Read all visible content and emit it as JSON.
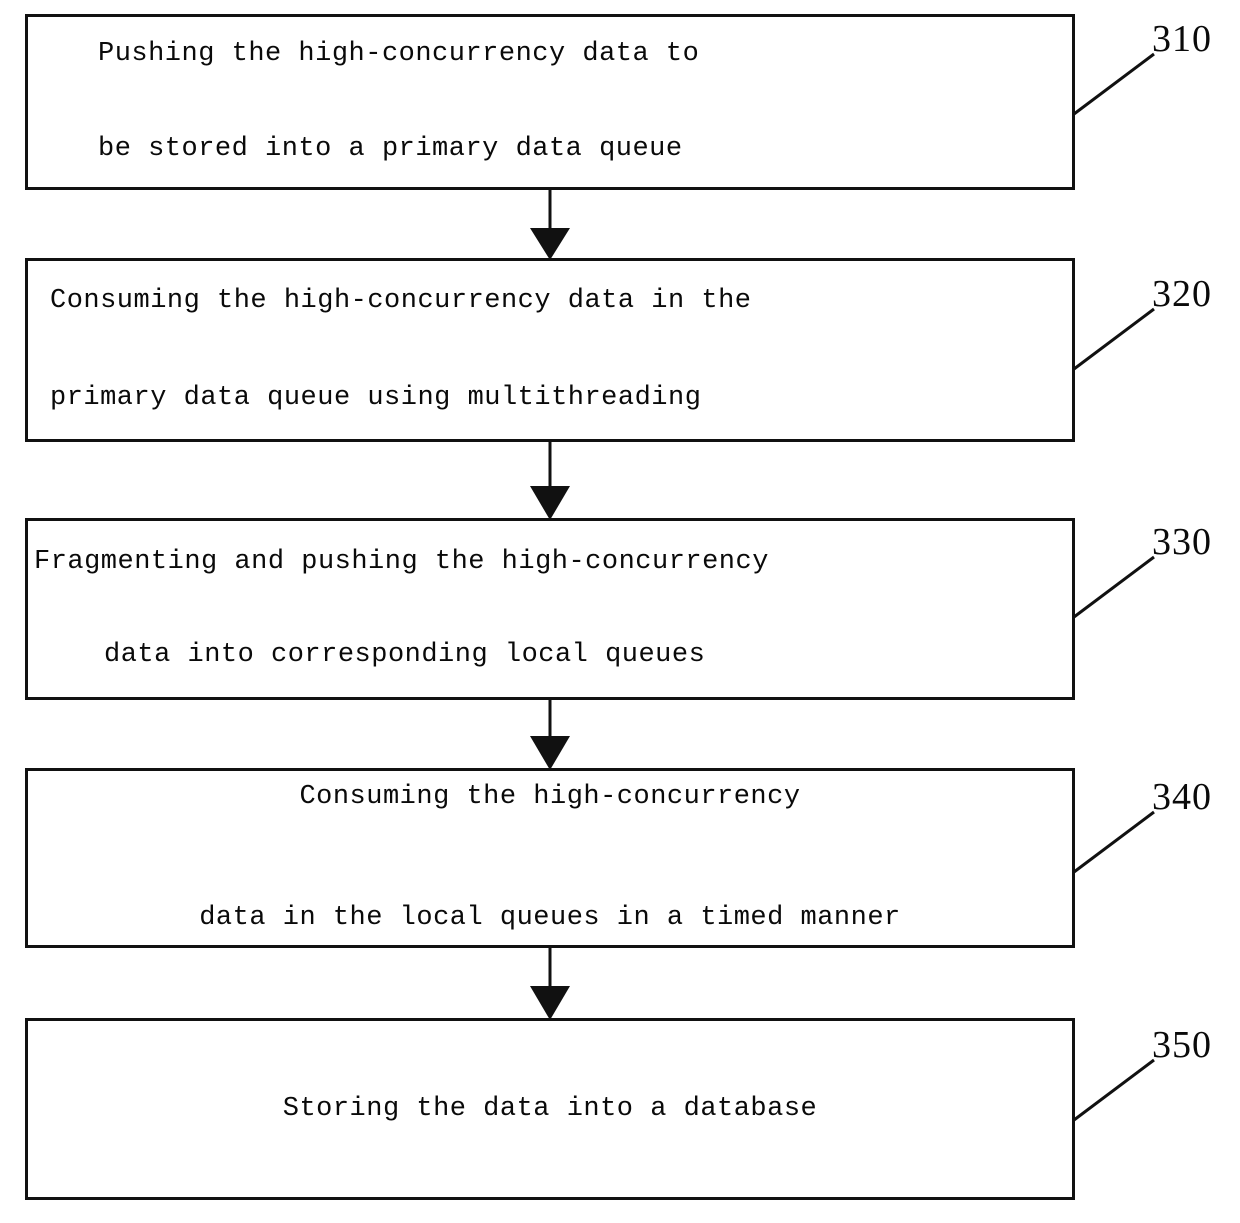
{
  "diagram": {
    "type": "flowchart",
    "orientation": "vertical",
    "title": "",
    "nodes": [
      {
        "ref": "310",
        "lines": [
          "Pushing the high-concurrency data to",
          "be stored into a primary data queue"
        ]
      },
      {
        "ref": "320",
        "lines": [
          "Consuming the high-concurrency data in the",
          "primary data queue using multithreading"
        ]
      },
      {
        "ref": "330",
        "lines": [
          "Fragmenting and pushing the high-concurrency",
          "data into corresponding local queues"
        ]
      },
      {
        "ref": "340",
        "lines": [
          "Consuming the high-concurrency",
          "data in the local queues in a timed manner"
        ]
      },
      {
        "ref": "350",
        "lines": [
          "Storing the data into a database"
        ]
      }
    ],
    "connectors": [
      {
        "from": "310",
        "to": "320",
        "arrowhead": "solid-triangle-down"
      },
      {
        "from": "320",
        "to": "330",
        "arrowhead": "solid-triangle-down"
      },
      {
        "from": "330",
        "to": "340",
        "arrowhead": "solid-triangle-down"
      },
      {
        "from": "340",
        "to": "350",
        "arrowhead": "solid-triangle-down"
      }
    ],
    "colors": {
      "background": "#ffffff",
      "stroke": "#111111",
      "text": "#0a0a0a"
    }
  }
}
